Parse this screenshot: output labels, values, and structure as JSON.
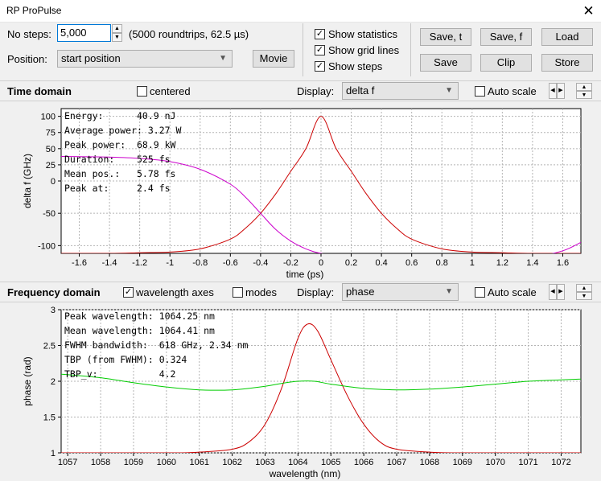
{
  "window": {
    "title": "RP ProPulse",
    "close": "✕"
  },
  "controls": {
    "no_steps_label": "No steps:",
    "no_steps_value": "5,000",
    "steps_info": "(5000 roundtrips, 62.5 µs)",
    "position_label": "Position:",
    "position_value": "start position",
    "movie_label": "Movie",
    "show_statistics": {
      "label": "Show statistics",
      "checked": true
    },
    "show_grid_lines": {
      "label": "Show grid lines",
      "checked": true
    },
    "show_steps": {
      "label": "Show steps",
      "checked": true
    },
    "buttons": {
      "save_t": "Save, t",
      "save_f": "Save, f",
      "load": "Load",
      "save": "Save",
      "clip": "Clip",
      "store": "Store"
    }
  },
  "time_section": {
    "title": "Time domain",
    "centered": {
      "label": "centered",
      "checked": false
    },
    "display_label": "Display:",
    "display_value": "delta f",
    "auto_scale": {
      "label": "Auto scale",
      "checked": false
    }
  },
  "freq_section": {
    "title": "Frequency domain",
    "wavelength_axes": {
      "label": "wavelength axes",
      "checked": true
    },
    "modes": {
      "label": "modes",
      "checked": false
    },
    "display_label": "Display:",
    "display_value": "phase",
    "auto_scale": {
      "label": "Auto scale",
      "checked": false
    }
  },
  "time_stats": [
    "Energy:      40.9 nJ",
    "Average power: 3.27 W",
    "Peak power:  68.9 kW",
    "Duration:    525 fs",
    "Mean pos.:   5.78 fs",
    "Peak at:     2.4 fs"
  ],
  "freq_stats": [
    "Peak wavelength: 1064.25 nm",
    "Mean wavelength: 1064.41 nm",
    "FWHM bandwidth:  618 GHz, 2.34 nm",
    "TBP (from FWHM): 0.324",
    "TBP_v:           4.2"
  ],
  "chart_data": [
    {
      "type": "line",
      "xlabel": "time (ps)",
      "ylabel": "delta f (GHz)",
      "xlim": [
        -1.72,
        1.72
      ],
      "ylim": [
        -112,
        112
      ],
      "xticks": [
        -1.6,
        -1.4,
        -1.2,
        -1,
        -0.8,
        -0.6,
        -0.4,
        -0.2,
        0,
        0.2,
        0.4,
        0.6,
        0.8,
        1,
        1.2,
        1.4,
        1.6
      ],
      "xtick_labels": [
        "-1.6",
        "-1.4",
        "-1.2",
        "-1",
        "-0.8",
        "-0.6",
        "-0.4",
        "-0.2",
        "0",
        "0.2",
        "0.4",
        "0.6",
        "0.8",
        "1",
        "1.2",
        "1.4",
        "1.6"
      ],
      "yticks": [
        100,
        75,
        50,
        25,
        0,
        -50,
        -100
      ],
      "ytick_labels": [
        "100",
        "75",
        "50",
        "25",
        "0",
        "-50",
        "-100"
      ],
      "grid": true,
      "series": [
        {
          "color": "#cc0000",
          "x": [
            -1.72,
            -1.4,
            -1.2,
            -1.0,
            -0.8,
            -0.6,
            -0.5,
            -0.4,
            -0.3,
            -0.2,
            -0.1,
            0,
            0.1,
            0.2,
            0.3,
            0.4,
            0.5,
            0.6,
            0.8,
            1.0,
            1.2,
            1.4,
            1.72
          ],
          "y": [
            -112,
            -112,
            -111,
            -110,
            -105,
            -90,
            -73,
            -50,
            -20,
            15,
            50,
            100,
            50,
            15,
            -20,
            -50,
            -73,
            -90,
            -105,
            -110,
            -111,
            -112,
            -112
          ]
        },
        {
          "color": "#cc00cc",
          "x": [
            -1.72,
            -1.4,
            -1.2,
            -1.0,
            -0.8,
            -0.6,
            -0.5,
            -0.4,
            -0.3,
            -0.2,
            -0.1,
            0,
            0.2,
            0.4,
            0.6,
            0.8,
            1.0,
            1.2,
            1.4,
            1.6,
            1.72
          ],
          "y": [
            38,
            37,
            35,
            30,
            18,
            -5,
            -25,
            -50,
            -75,
            -93,
            -105,
            -112,
            -118,
            -120,
            -121,
            -122,
            -122,
            -121,
            -118,
            -108,
            -95
          ]
        }
      ]
    },
    {
      "type": "line",
      "xlabel": "wavelength (nm)",
      "ylabel": "phase (rad)",
      "xlim": [
        1056.8,
        1072.6
      ],
      "ylim": [
        1,
        3
      ],
      "xticks": [
        1057,
        1058,
        1059,
        1060,
        1061,
        1062,
        1063,
        1064,
        1065,
        1066,
        1067,
        1068,
        1069,
        1070,
        1071,
        1072
      ],
      "xtick_labels": [
        "1057",
        "1058",
        "1059",
        "1060",
        "1061",
        "1062",
        "1063",
        "1064",
        "1065",
        "1066",
        "1067",
        "1068",
        "1069",
        "1070",
        "1071",
        "1072"
      ],
      "yticks": [
        3,
        2.5,
        2,
        1.5,
        1
      ],
      "ytick_labels": [
        "3",
        "2.5",
        "2",
        "1.5",
        "1"
      ],
      "grid": true,
      "series": [
        {
          "color": "#cc0000",
          "x": [
            1056.8,
            1060,
            1061,
            1062,
            1062.5,
            1063,
            1063.5,
            1064,
            1064.3,
            1064.6,
            1065,
            1065.5,
            1066,
            1066.5,
            1067,
            1068,
            1069,
            1072.6
          ],
          "y": [
            1,
            1,
            1.01,
            1.05,
            1.15,
            1.4,
            1.9,
            2.6,
            2.8,
            2.7,
            2.3,
            1.8,
            1.4,
            1.15,
            1.05,
            1.01,
            1,
            1
          ]
        },
        {
          "color": "#00cc00",
          "x": [
            1056.8,
            1058,
            1059,
            1060,
            1061,
            1062,
            1063,
            1063.5,
            1064,
            1064.5,
            1065,
            1066,
            1067,
            1068,
            1069,
            1070,
            1071,
            1072,
            1072.6
          ],
          "y": [
            2.1,
            2.05,
            1.98,
            1.92,
            1.88,
            1.88,
            1.93,
            1.97,
            2.0,
            2.0,
            1.96,
            1.9,
            1.88,
            1.89,
            1.92,
            1.96,
            2.0,
            2.02,
            2.03
          ]
        }
      ]
    }
  ]
}
